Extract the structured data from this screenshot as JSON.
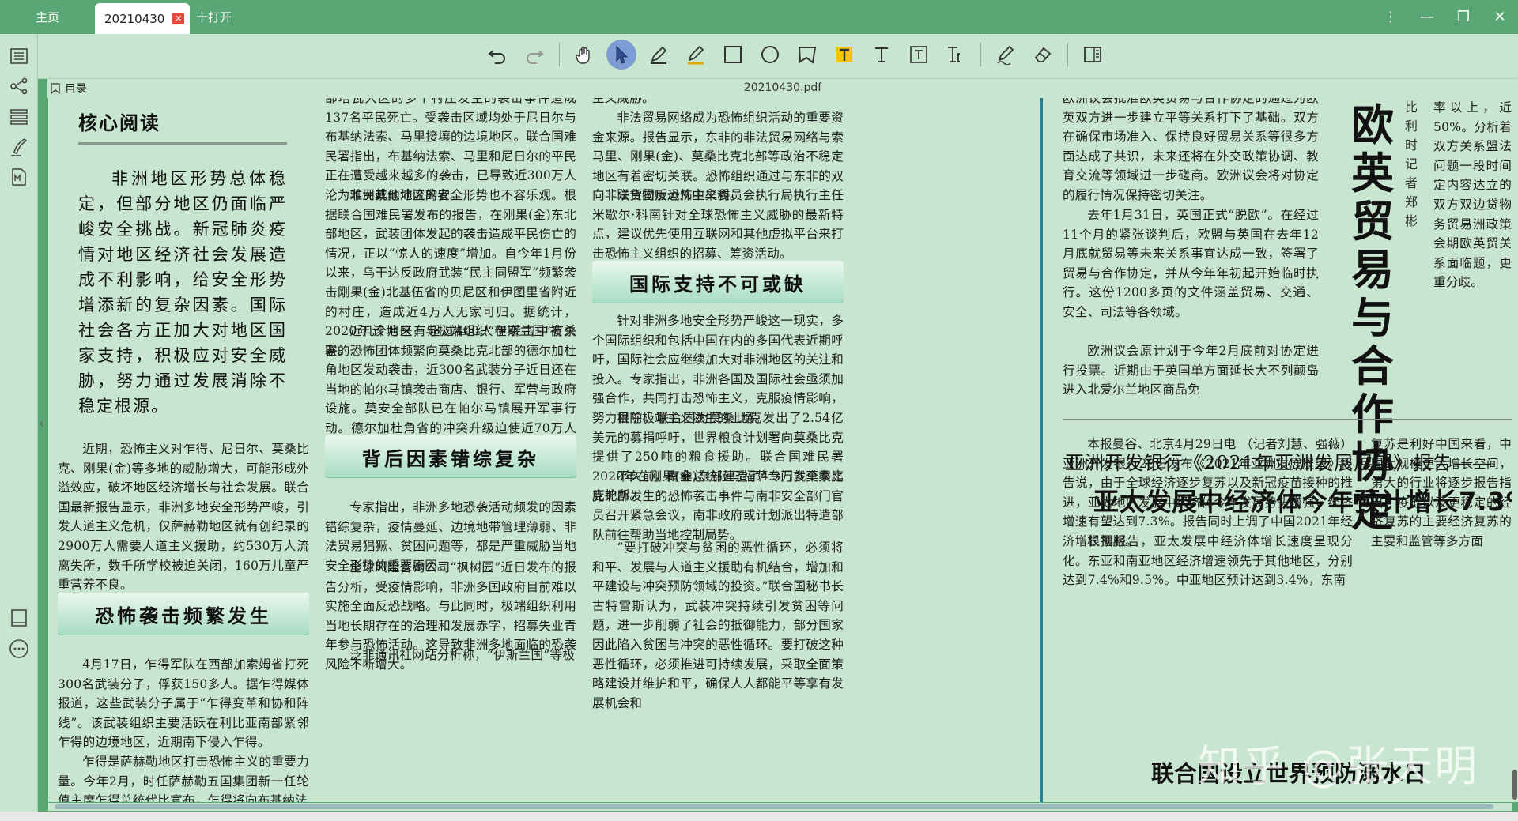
{
  "tabs": {
    "home": "主页",
    "doc": "20210430",
    "open": "十打开"
  },
  "window": {
    "menu": "⋮",
    "minimize": "—",
    "restore": "❐",
    "close": "✕"
  },
  "outline": {
    "label": "目录",
    "filename": "20210430.pdf"
  },
  "toolbar_icons": [
    "undo-icon",
    "redo-icon",
    "hand-icon",
    "select-icon",
    "pen-icon",
    "highlighter-icon",
    "rectangle-icon",
    "ellipse-icon",
    "polygon-icon",
    "text-highlight-icon",
    "text-icon",
    "textbox-icon",
    "text-insert-icon",
    "sign-icon",
    "eraser-icon",
    "panel-icon"
  ],
  "article": {
    "core_title": "核心阅读",
    "lead": "非洲地区形势总体稳定，但部分地区仍面临严峻安全挑战。新冠肺炎疫情对地区经济社会发展造成不利影响，给安全形势增添新的复杂因素。国际社会各方正加大对地区国家支持，积极应对安全威胁，努力通过发展消除不稳定根源。",
    "col1_p1": "近期，恐怖主义对乍得、尼日尔、莫桑比克、刚果(金)等多地的威胁增大，可能形成外溢效应，破坏地区经济增长与社会发展。联合国最新报告显示，非洲多地安全形势严峻，引发人道主义危机，仅萨赫勒地区就有创纪录的2900万人需要人道主义援助，约530万人流离失所，数千所学校被迫关闭，160万儿童严重营养不良。",
    "subhead1": "恐怖袭击频繁发生",
    "col1_p2": "4月17日，乍得军队在西部加索姆省打死300名武装分子，俘获150多人。据乍得媒体报道，这些武装分子属于“乍得变革和协和阵线”。该武装组织主要活跃在利比亚南部紧邻乍得的边境地区，近期南下侵入乍得。",
    "col1_p3": "乍得是萨赫勒地区打击恐怖主义的重要力量。今年2月，时任萨赫勒五国集团新一任轮值主席乍得总统代比宣布，乍得将向布基纳法",
    "col2_p1": "部塔瓦大区的多个村庄发生的袭击事件造成137名平民死亡。受袭击区域均处于尼日尔与布基纳法索、马里接壤的边境地区。联合国难民署指出，布基纳法索、马里和尼日尔的平民正在遭受越来越多的袭击，已导致近300万人沦为难民或颠沛流离者。",
    "col2_p2": "非洲其他地区的安全形势也不容乐观。根据联合国难民署发布的报告，在刚果(金)东北部地区，武装团体发起的袭击造成平民伤亡的情况，正以“惊人的速度”增加。自今年1月份以来，乌干达反政府武装“民主同盟军”频繁袭击刚果(金)北基伍省的贝尼区和伊图里省附近的村庄，造成近4万人无家可归。据统计，2020年该地区有超过400人在袭击中被杀害。",
    "col2_p3": "近几个月来，与极端组织“伊斯兰国”有关联的恐怖团体频繁向莫桑比克北部的德尔加杜角地区发动袭击，近300名武装分子近日还在当地的帕尔马镇袭击商店、银行、军营与政府设施。莫安全部队已在帕尔马镇展开军事行动。德尔加杜角省的冲突升级迫使近70万人逃离家园，其中一半是儿童。",
    "subhead2": "背后因素错综复杂",
    "col2_p4": "专家指出，非洲多地恐袭活动频发的因素错综复杂，疫情蔓延、边境地带管理薄弱、非法贸易猖獗、贫困问题等，都是严重威胁当地安全形势的重要原因。",
    "col2_p5": "全球风险咨询公司“枫树园”近日发布的报告分析，受疫情影响，非洲多国政府目前难以实施全面反恐战略。与此同时，极端组织利用当地长期存在的治理和发展赤字，招募失业青年参与恐怖活动。这导致非洲多地面临的恐袭风险不断增大。",
    "col2_p6": "泛非通讯社网站分析称，“伊斯兰国”等极",
    "col3_p1": "主义威胁。",
    "col3_p2": "非法贸易网络成为恐怖组织活动的重要资金来源。报告显示，东非的非法贸易网络与索马里、刚果(金)、莫桑比克北部等政治不稳定地区有着密切关联。恐怖组织通过与东非的双向非法货物贩运从中牟利。",
    "col3_p3": "联合国反恐怖主义委员会执行局执行主任米歇尔·科南针对全球恐怖主义威胁的最新特点，建议优先使用互联网和其他虚拟平台来打击恐怖主义组织的招募、筹资活动。",
    "subhead3": "国际支持不可或缺",
    "col3_p4": "针对非洲多地安全形势严峻这一现实，多个国际组织和包括中国在内的多国代表近期呼吁，国际社会应继续加大对非洲地区的关注和投入。专家指出，非洲各国及国际社会亟须加强合作，共同打击恐怖主义，克服疫情影响，努力根除极端主义滋生的土壤。",
    "col3_p5": "目前，联合国为莫桑比克发出了2.54亿美元的募捐呼吁，世界粮食计划署向莫桑比克提供了250吨的粮食援助。联合国难民署2020年在刚果(金)东部建造了4.3万多个家庭庇护所。",
    "col3_p6": "不久前，南非总统拉马福萨专门就莫桑比克北部发生的恐怖袭击事件与南非安全部门官员召开紧急会议，南非政府或计划派出特遣部队前往帮助当地控制局势。",
    "col3_p7": "“要打破冲突与贫困的恶性循环，必须将和平、发展与人道主义援助有机结合，增加和平建设与冲突预防领域的投资。”联合国秘书长古特雷斯认为，武装冲突持续引发贫困等问题，进一步削弱了社会的抵御能力，部分国家因此陷入贫困与冲突的恶性循环。要打破这种恶性循环，必须推进可持续发展，采取全面策略建设并维护和平，确保人人都能平等享有发展机会和",
    "col4_p1": "欧洲议会批准欧英贸易与合作协定的通过为欧英双方进一步建立平等关系打下了基础。双方在确保市场准入、保持良好贸易关系等很多方面达成了共识，未来还将在外交政策协调、教育交流等领域进一步磋商。欧洲议会将对协定的履行情况保持密切关注。",
    "col4_p2": "去年1月31日，英国正式“脱欧”。在经过11个月的紧张谈判后，欧盟与英国在去年12月底就贸易等未来关系事宜达成一致，签署了贸易与合作协定，并从今年年初起开始临时执行。这份1200多页的文件涵盖贸易、交通、安全、司法等各领域。",
    "col4_p3": "欧洲议会原计划于今年2月底前对协定进行投票。近期由于英国单方面延长大不列颠岛进入北爱尔兰地区商品免",
    "big_title": "欧英贸易与合作协定",
    "byline": "比利时记者郑彬",
    "col5_text": "率以上，近50%。分析着双方关系盟法问题一段时间定内容达立的双方双边贷物务贸易洲政策会期欧英贸关系面临题，更重分歧。",
    "adb_kicker": "亚洲开发银行《2021年亚洲发展展望》报告——",
    "adb_title": "亚太发展中经济体今年预计增长7.3%",
    "adb_p1": "本报曼谷、北京4月29日电 （记者刘慧、强薇）亚洲开发银行28日发布《2021年亚洲发展展望》报告说，由于全球经济逐步复苏以及新冠疫苗接种的推进，亚太地区发展中经济体今年发展势头增强，经济增速有望达到7.3%。报告同时上调了中国2021年经济增长预期。",
    "adb_p2": "根据报告，亚太发展中经济体增长速度呈现分化。东亚和南亚地区经济增速领先于其他地区，分别达到7.4%和9.5%。中亚地区预计达到3.4%，东南",
    "adb_col2": "复苏是利好中国来看，中国大规模更大增长空间，第大的行业将逐步报告指出，疫苏以及更稳定的经济复苏的主要经济复苏的主要和监管等多方面",
    "bottom_title": "联合国设立世界预防溺水日"
  },
  "watermark": "知乎 @张天明"
}
